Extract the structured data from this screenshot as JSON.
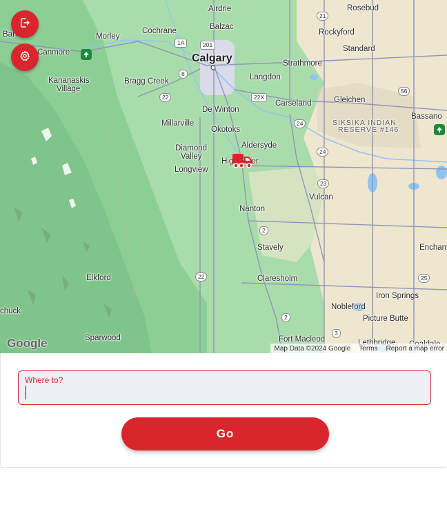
{
  "map": {
    "places": {
      "airdrie": "Airdrie",
      "rosebud": "Rosebud",
      "cochrane": "Cochrane",
      "balzac": "Balzac",
      "rockyford": "Rockyford",
      "morley": "Morley",
      "banff": "Banff",
      "canmore": "Canmore",
      "calgary": "Calgary",
      "standard": "Standard",
      "strathmore": "Strathmore",
      "kananaskis": "Kananaskis",
      "kananaskis_village": "Village",
      "bragg_creek": "Bragg Creek",
      "langdon": "Langdon",
      "carseland": "Carseland",
      "gleichen": "Gleichen",
      "de_winton": "De Winton",
      "millarville": "Millarville",
      "okotoks": "Okotoks",
      "bassano": "Bassano",
      "siksika": "SIKSIKA INDIAN",
      "siksika2": "RESERVE #146",
      "aldersyde": "Aldersyde",
      "diamond": "Diamond",
      "valley": "Valley",
      "high_river": "High River",
      "longview": "Longview",
      "vulcan": "Vulcan",
      "nanton": "Nanton",
      "enchant": "Enchant",
      "stavely": "Stavely",
      "elkford": "Elkford",
      "claresholm": "Claresholm",
      "iron_springs": "Iron Springs",
      "nobleford": "Nobleford",
      "chuck": "chuck",
      "picture_butte": "Picture Butte",
      "sparwood": "Sparwood",
      "fort_macleod": "Fort Macleod",
      "lethbridge": "Lethbridge",
      "coaldale": "Coaldale"
    },
    "shields": {
      "s201": "201",
      "s1a": "1A",
      "s21": "21",
      "s8": "8",
      "s22": "22",
      "s22x": "22X",
      "s56": "56",
      "s24a": "24",
      "s24b": "24",
      "s23": "23",
      "s2a": "2",
      "s22b": "22",
      "s25": "25",
      "s2b": "2",
      "s3": "3"
    },
    "attribution": "Map Data ©2024 Google",
    "terms": "Terms",
    "report": "Report a map error",
    "google_logo": "Google",
    "colors": {
      "brand_red": "#d8262c",
      "map_green": "#a7d9a8",
      "farmland": "#efe6cf"
    }
  },
  "controls": {
    "exit_icon": "exit-icon",
    "settings_icon": "settings-icon"
  },
  "form": {
    "label": "Where to?",
    "value": "",
    "go_label": "Go"
  }
}
